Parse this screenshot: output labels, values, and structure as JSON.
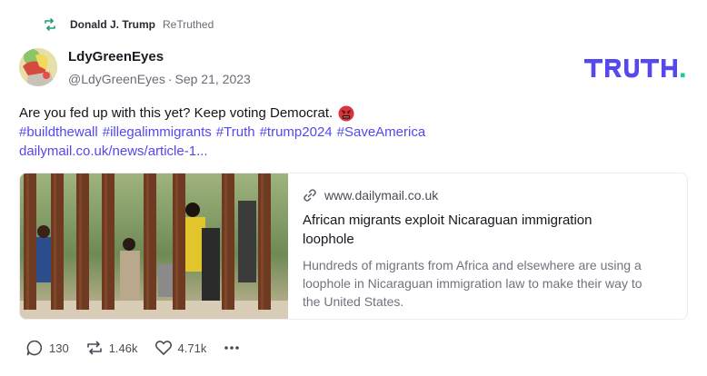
{
  "retruth": {
    "user": "Donald J. Trump",
    "verb": "ReTruthed",
    "icon": "retruth-icon"
  },
  "author": {
    "name": "LdyGreenEyes",
    "handle": "@LdyGreenEyes",
    "separator": "·",
    "date": "Sep 21, 2023"
  },
  "brand": {
    "logo_text": "TRUTH."
  },
  "post": {
    "text": "Are you fed up with this yet? Keep voting Democrat.",
    "emoji": "angry-cursing-face-emoji",
    "hashtags": [
      "#buildthewall",
      "#illegalimmigrants",
      "#Truth",
      "#trump2024",
      "#SaveAmerica"
    ],
    "link": "dailymail.co.uk/news/article-1..."
  },
  "card": {
    "domain": "www.dailymail.co.uk",
    "title": "African migrants exploit Nicaraguan immigration loophole",
    "description": "Hundreds of migrants from Africa and elsewhere are using a loophole in Nicaraguan immigration law to make their way to the United States."
  },
  "actions": {
    "replies": "130",
    "retruths": "1.46k",
    "likes": "4.71k"
  },
  "colors": {
    "accent": "#5448ee",
    "muted": "#6b6b76",
    "retruth_green": "#1aa06d"
  }
}
